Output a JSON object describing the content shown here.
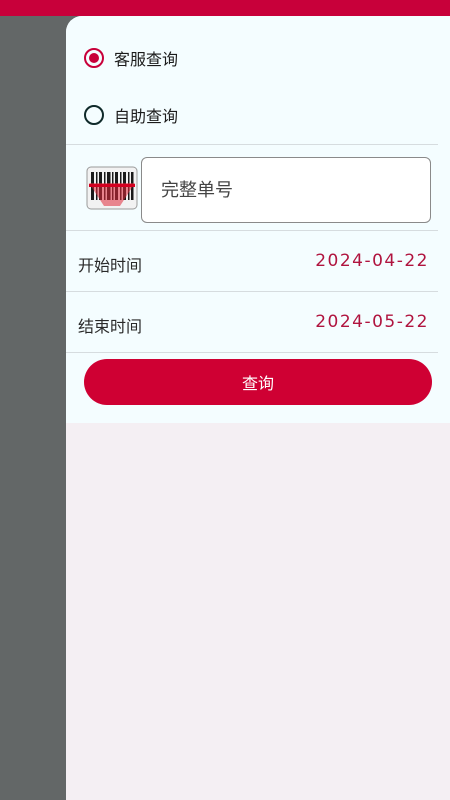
{
  "query_type": {
    "options": [
      {
        "label": "客服查询",
        "selected": true
      },
      {
        "label": "自助查询",
        "selected": false
      }
    ]
  },
  "order_input": {
    "value": "",
    "placeholder": "完整单号"
  },
  "start_date": {
    "label": "开始时间",
    "value": "2024-04-22"
  },
  "end_date": {
    "label": "结束时间",
    "value": "2024-05-22"
  },
  "submit": {
    "label": "查询"
  },
  "colors": {
    "accent": "#cf0033",
    "date_text": "#b0143f",
    "sidebar": "#636767"
  },
  "icons": {
    "scan": "barcode-scan-icon"
  }
}
